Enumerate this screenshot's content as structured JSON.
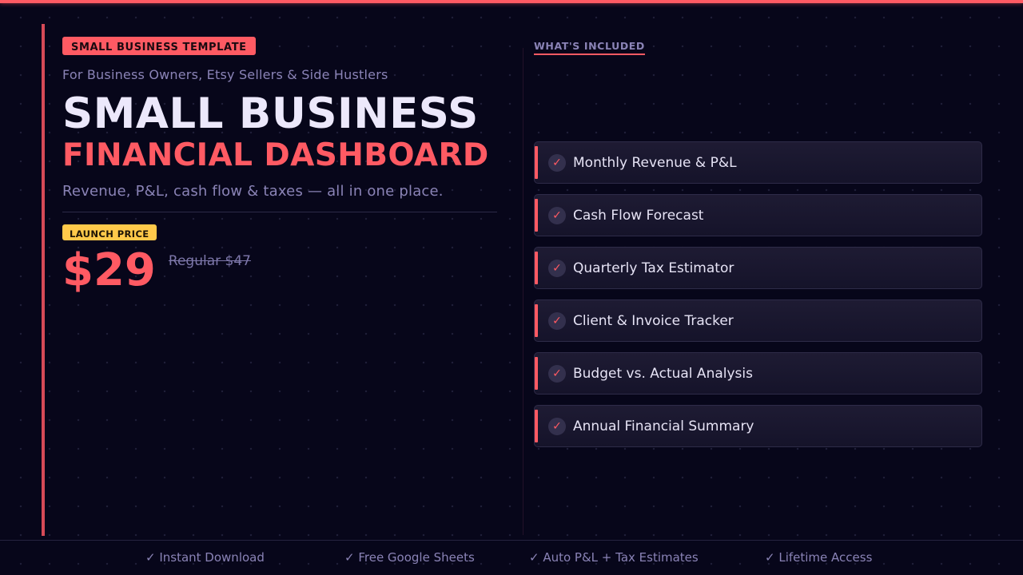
{
  "badge": "SMALL BUSINESS TEMPLATE",
  "audience": "For Business Owners, Etsy Sellers & Side Hustlers",
  "title_line1": "SMALL BUSINESS",
  "title_line2": "FINANCIAL DASHBOARD",
  "tagline": "Revenue, P&L, cash flow & taxes — all in one place.",
  "launch_label": "LAUNCH PRICE",
  "price": "$29",
  "regular_price": "Regular $47",
  "section_label": "WHAT'S INCLUDED",
  "check_icon": "✓",
  "features": [
    "Monthly Revenue & P&L",
    "Cash Flow Forecast",
    "Quarterly Tax Estimator",
    "Client & Invoice Tracker",
    "Budget vs. Actual Analysis",
    "Annual Financial Summary"
  ],
  "footer": [
    "✓ Instant Download",
    "✓ Free Google Sheets",
    "✓ Auto P&L + Tax Estimates",
    "✓ Lifetime Access"
  ],
  "colors": {
    "background": "#07061a",
    "accent": "#ff5a63",
    "launch_badge": "#ffc94a",
    "muted_text": "#8a83b6",
    "title_text": "#ece8fb"
  }
}
